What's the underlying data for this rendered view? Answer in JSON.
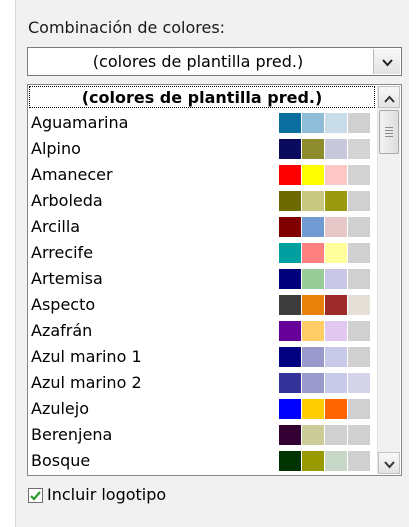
{
  "color_scheme": {
    "label": "Combinación de colores:",
    "selected": "(colores de plantilla pred.)",
    "dropdown_icon": "chevron-down-icon",
    "options": [
      {
        "name": "(colores de plantilla pred.)",
        "colors": []
      },
      {
        "name": "Aguamarina",
        "colors": [
          "#0b6ea0",
          "#8fbcd7",
          "#c9dcea",
          "#d0d0d0"
        ]
      },
      {
        "name": "Alpino",
        "colors": [
          "#0a0a5e",
          "#8c8c2c",
          "#c8c8dc",
          "#d4d4d4"
        ]
      },
      {
        "name": "Amanecer",
        "colors": [
          "#ff0000",
          "#ffff00",
          "#ffc8c8",
          "#d2d2d2"
        ]
      },
      {
        "name": "Arboleda",
        "colors": [
          "#6b6b00",
          "#c8c880",
          "#9a9a10",
          "#d0d0d0"
        ]
      },
      {
        "name": "Arcilla",
        "colors": [
          "#800000",
          "#6f9bd2",
          "#e6c8c8",
          "#d0d0d0"
        ]
      },
      {
        "name": "Arrecife",
        "colors": [
          "#00a0a0",
          "#ff8080",
          "#ffff9c",
          "#d0d0d0"
        ]
      },
      {
        "name": "Artemisa",
        "colors": [
          "#00007a",
          "#99cc99",
          "#c8c8e6",
          "#d0d0d0"
        ]
      },
      {
        "name": "Aspecto",
        "colors": [
          "#3c3c3c",
          "#e8800a",
          "#9e2a2a",
          "#e4e0d8"
        ]
      },
      {
        "name": "Azafrán",
        "colors": [
          "#660099",
          "#ffcc66",
          "#e0c8f0",
          "#d0d0d0"
        ]
      },
      {
        "name": "Azul marino 1",
        "colors": [
          "#000080",
          "#9999cc",
          "#c8c8e8",
          "#d0d0d0"
        ]
      },
      {
        "name": "Azul marino 2",
        "colors": [
          "#333399",
          "#9999cc",
          "#c8c8e8",
          "#d4d4e8"
        ]
      },
      {
        "name": "Azulejo",
        "colors": [
          "#0000ff",
          "#ffcc00",
          "#ff6600",
          "#d0d0d0"
        ]
      },
      {
        "name": "Berenjena",
        "colors": [
          "#330033",
          "#cccc99",
          "#d0d0d0",
          "#d0d0d0"
        ]
      },
      {
        "name": "Bosque",
        "colors": [
          "#003300",
          "#999900",
          "#c8d8c8",
          "#d0d0d0"
        ]
      }
    ]
  },
  "scrollbar": {
    "up_icon": "chevron-up-icon",
    "down_icon": "chevron-down-icon"
  },
  "include_logo": {
    "label": "Incluir logotipo",
    "checked": true,
    "check_color": "#2a9a2a"
  }
}
